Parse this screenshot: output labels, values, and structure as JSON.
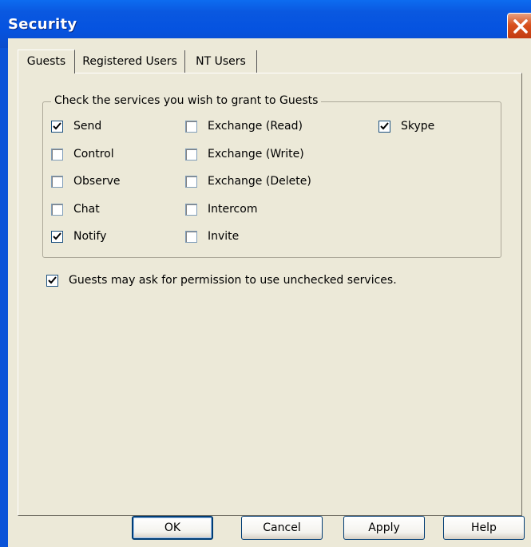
{
  "window": {
    "title": "Security"
  },
  "tabs": [
    {
      "label": "Guests",
      "active": true
    },
    {
      "label": "Registered Users",
      "active": false
    },
    {
      "label": "NT Users",
      "active": false
    }
  ],
  "group": {
    "label": "Check the services you wish to grant to Guests"
  },
  "services": [
    {
      "label": "Send",
      "checked": true
    },
    {
      "label": "Control",
      "checked": false
    },
    {
      "label": "Observe",
      "checked": false
    },
    {
      "label": "Chat",
      "checked": false
    },
    {
      "label": "Notify",
      "checked": true
    },
    {
      "label": "Exchange (Read)",
      "checked": false
    },
    {
      "label": "Exchange (Write)",
      "checked": false
    },
    {
      "label": "Exchange (Delete)",
      "checked": false
    },
    {
      "label": "Intercom",
      "checked": false
    },
    {
      "label": "Invite",
      "checked": false
    },
    {
      "label": "Skype",
      "checked": true
    }
  ],
  "permission": {
    "label": "Guests may ask for permission to use unchecked services.",
    "checked": true
  },
  "buttons": {
    "ok": "OK",
    "cancel": "Cancel",
    "apply": "Apply",
    "help": "Help"
  },
  "icons": {
    "close": "close-icon",
    "check": "checkmark-icon"
  },
  "colors": {
    "titlebar": "#0553e0",
    "close": "#d8501c",
    "face": "#ece9d8"
  }
}
